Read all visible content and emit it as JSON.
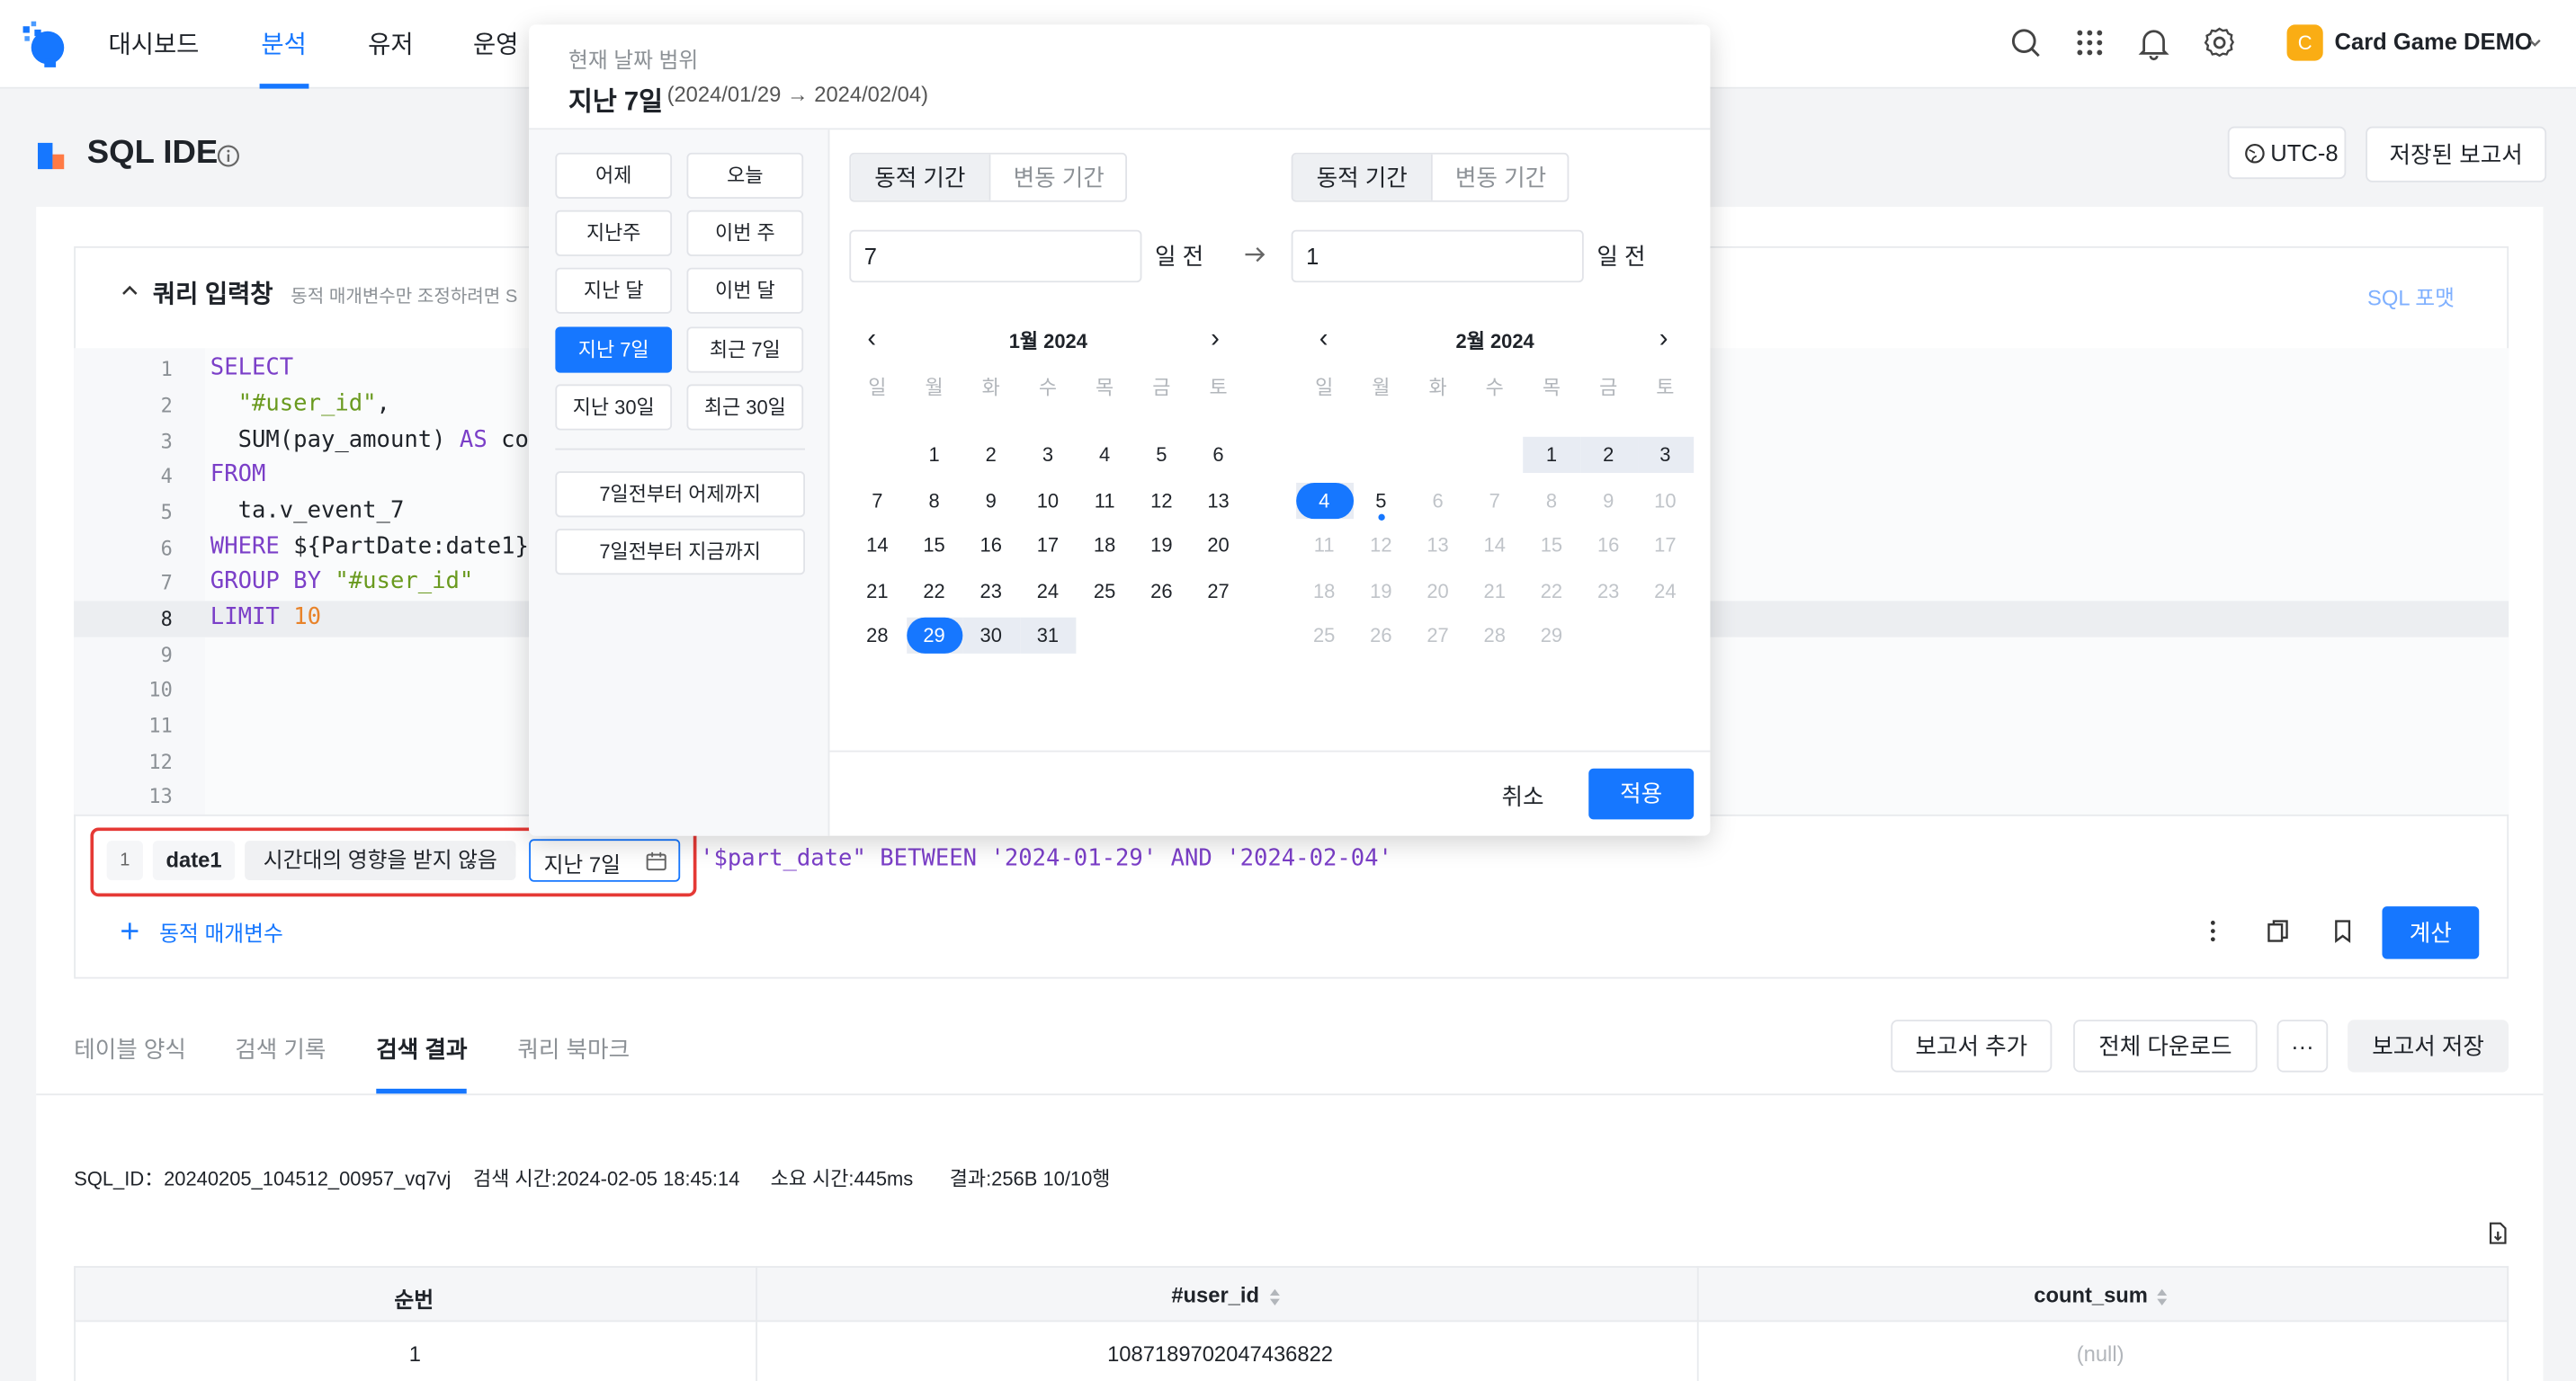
{
  "nav": {
    "items": [
      "대시보드",
      "분석",
      "유저",
      "운영"
    ],
    "active_index": 1,
    "project_badge": "C",
    "project_name": "Card Game DEMO"
  },
  "header": {
    "title": "SQL IDE",
    "timezone": "UTC-8",
    "saved_reports": "저장된 보고서"
  },
  "editor": {
    "panel_title": "쿼리 입력창",
    "panel_hint": "동적 매개변수만 조정하려면 S",
    "format_link": "SQL 포맷",
    "line_numbers": [
      "1",
      "2",
      "3",
      "4",
      "5",
      "6",
      "7",
      "8",
      "9",
      "10",
      "11",
      "12",
      "13"
    ],
    "current_line": "8",
    "lines": {
      "l1": "SELECT",
      "l2": "\"#user_id\"",
      "l2b": ",",
      "l3": "SUM(pay_amount)",
      "l3kw": " AS ",
      "l3c": "cou",
      "l4": "FROM",
      "l5": "ta.v_event_7",
      "l6kw": "WHERE",
      "l6": " ${PartDate:date1}",
      "l7kw": "GROUP BY",
      "l7": " \"#user_id\"",
      "l8kw": "LIMIT",
      "l8": " 10"
    }
  },
  "param": {
    "index": "1",
    "name": "date1",
    "timezone_mode": "시간대의 영향을 받지 않음",
    "range_value": "지난 7일",
    "preview_str": "'$part_date\"",
    "preview_between": " BETWEEN ",
    "preview_from": "'2024-01-29'",
    "preview_and": " AND ",
    "preview_to": "'2024-02-04'",
    "add_label": "동적 매개변수",
    "compute": "계산"
  },
  "result_tabs": [
    "테이블 양식",
    "검색 기록",
    "검색 결과",
    "쿼리 북마크"
  ],
  "result_active": 2,
  "result_actions": {
    "add_report": "보고서 추가",
    "download_all": "전체 다운로드",
    "more": "···",
    "save_report": "보고서 저장"
  },
  "meta": {
    "sql_id": "SQL_ID：20240205_104512_00957_vq7vj",
    "query_time": "검색 시간:2024-02-05 18:45:14",
    "elapsed": "소요 시간:445ms",
    "result": "결과:256B 10/10행"
  },
  "table": {
    "columns": [
      "순번",
      "#user_id",
      "count_sum"
    ],
    "rows": [
      [
        "1",
        "1087189702047436822",
        "(null)"
      ]
    ]
  },
  "picker": {
    "current_label": "현재 날짜 범위",
    "current_value": "지난 7일",
    "current_dates": "(2024/01/29 → 2024/02/04)",
    "presets": [
      "어제",
      "오늘",
      "지난주",
      "이번 주",
      "지난 달",
      "이번 달",
      "지난 7일",
      "최근 7일",
      "지난 30일",
      "최근 30일"
    ],
    "selected_preset": "지난 7일",
    "preset_wide": [
      "7일전부터 어제까지",
      "7일전부터 지금까지"
    ],
    "left": {
      "mode_dynamic": "동적 기간",
      "mode_fixed": "변동 기간",
      "value": "7",
      "suffix": "일 전"
    },
    "right": {
      "mode_dynamic": "동적 기간",
      "mode_fixed": "변동 기간",
      "value": "1",
      "suffix": "일 전"
    },
    "weekdays": [
      "일",
      "월",
      "화",
      "수",
      "목",
      "금",
      "토"
    ],
    "cal_left": {
      "title": "1월 2024",
      "prev": "‹",
      "next": "›",
      "first_weekday": 1,
      "days": 31,
      "range_start": 29,
      "range_end": 31,
      "selected": 29
    },
    "cal_right": {
      "title": "2월 2024",
      "prev": "‹",
      "next": "›",
      "first_weekday": 4,
      "days": 29,
      "range_start": 1,
      "range_end": 4,
      "selected": 4,
      "today": 5,
      "disabled_from": 6
    },
    "cancel": "취소",
    "apply": "적용"
  }
}
